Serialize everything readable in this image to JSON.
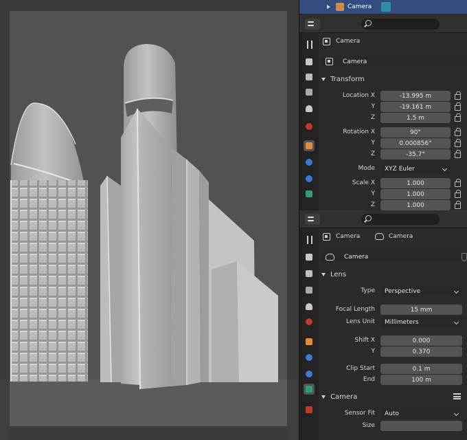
{
  "outliner": {
    "selected_item": "Camera"
  },
  "object_panel": {
    "breadcrumb": "Camera",
    "object_name": "Camera",
    "transform": {
      "section_title": "Transform",
      "location_label": "Location X",
      "location": [
        "-13.995 m",
        "-19.161 m",
        "1.5 m"
      ],
      "rotation_label": "Rotation X",
      "rotation": [
        "90°",
        "0.000856°",
        "-35.7°"
      ],
      "mode_label": "Mode",
      "mode_value": "XYZ Euler",
      "scale_label": "Scale X",
      "scale": [
        "1.000",
        "1.000",
        "1.000"
      ],
      "y_label": "Y",
      "z_label": "Z"
    }
  },
  "camera_panel": {
    "breadcrumb_object": "Camera",
    "breadcrumb_data": "Camera",
    "data_name": "Camera",
    "lens": {
      "section_title": "Lens",
      "type_label": "Type",
      "type_value": "Perspective",
      "focal_length_label": "Focal Length",
      "focal_length_value": "15 mm",
      "lens_unit_label": "Lens Unit",
      "lens_unit_value": "Millimeters",
      "shift_x_label": "Shift X",
      "shift_x_value": "0.000",
      "shift_y_label": "Y",
      "shift_y_value": "0.370",
      "clip_start_label": "Clip Start",
      "clip_start_value": "0.1 m",
      "clip_end_label": "End",
      "clip_end_value": "100 m"
    },
    "camera_section": {
      "section_title": "Camera",
      "sensor_fit_label": "Sensor Fit",
      "sensor_fit_value": "Auto",
      "size_label": "Size"
    }
  },
  "colors": {
    "accent_selected": "#334d80",
    "object_tab": "#e38c3a",
    "camera_tab": "#2fa06b"
  }
}
